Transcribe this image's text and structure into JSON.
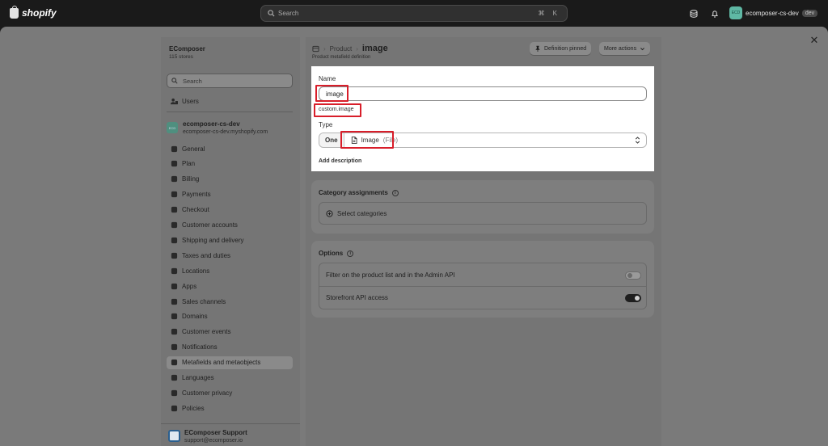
{
  "topbar": {
    "brand": "shopify",
    "search_placeholder": "Search",
    "search_shortcut": "⌘ K",
    "avatar_initials": "ECD",
    "store_name": "ecomposer-cs-dev",
    "store_badge": "dev"
  },
  "sidebar": {
    "org_name": "EComposer",
    "org_count": "115 stores",
    "search_placeholder": "Search",
    "users_label": "Users",
    "store_name": "ecomposer-cs-dev",
    "store_url": "ecomposer-cs-dev.myshopify.com",
    "store_initials": "ECD",
    "items": [
      {
        "label": "General",
        "icon": "store-icon"
      },
      {
        "label": "Plan",
        "icon": "plan-icon"
      },
      {
        "label": "Billing",
        "icon": "billing-icon"
      },
      {
        "label": "Payments",
        "icon": "payments-icon"
      },
      {
        "label": "Checkout",
        "icon": "cart-icon"
      },
      {
        "label": "Customer accounts",
        "icon": "person-icon"
      },
      {
        "label": "Shipping and delivery",
        "icon": "truck-icon"
      },
      {
        "label": "Taxes and duties",
        "icon": "tax-icon"
      },
      {
        "label": "Locations",
        "icon": "location-icon"
      },
      {
        "label": "Apps",
        "icon": "apps-icon"
      },
      {
        "label": "Sales channels",
        "icon": "channels-icon"
      },
      {
        "label": "Domains",
        "icon": "globe-icon"
      },
      {
        "label": "Customer events",
        "icon": "cursor-icon"
      },
      {
        "label": "Notifications",
        "icon": "bell-icon"
      },
      {
        "label": "Metafields and metaobjects",
        "icon": "metafields-icon",
        "active": true
      },
      {
        "label": "Languages",
        "icon": "language-icon"
      },
      {
        "label": "Customer privacy",
        "icon": "lock-icon"
      },
      {
        "label": "Policies",
        "icon": "policy-icon"
      }
    ],
    "support_name": "EComposer Support",
    "support_email": "support@ecomposer.io"
  },
  "header": {
    "breadcrumb_parent": "Product",
    "breadcrumb_sep": "›",
    "title": "image",
    "subtitle": "Product metafield definition",
    "pinned_label": "Definition pinned",
    "more_actions_label": "More actions"
  },
  "definition": {
    "name_label": "Name",
    "name_value": "image",
    "namespace_key": "custom.image",
    "type_label": "Type",
    "type_cardinality": "One",
    "type_name": "Image",
    "type_detail": "(File)",
    "add_description": "Add description"
  },
  "category": {
    "title": "Category assignments",
    "select_label": "Select categories"
  },
  "options": {
    "title": "Options",
    "filter_label": "Filter on the product list and in the Admin API",
    "filter_enabled": false,
    "storefront_label": "Storefront API access",
    "storefront_enabled": true
  }
}
